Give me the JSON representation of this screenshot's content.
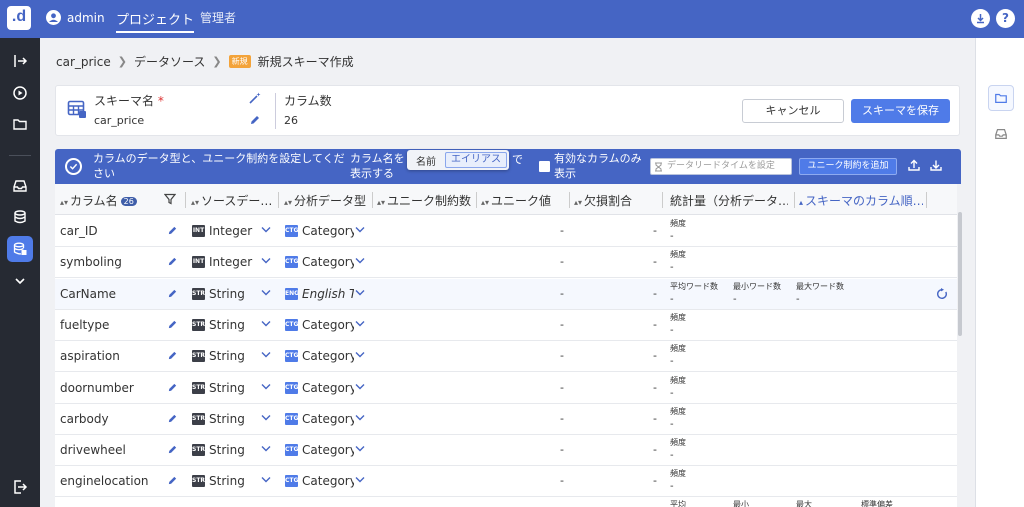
{
  "topbar": {
    "logo": ".d",
    "user": "admin",
    "nav_project": "プロジェクト",
    "nav_admin": "管理者",
    "help": "?"
  },
  "breadcrumb": {
    "items": [
      "car_price",
      "データソース"
    ],
    "badge": "新規",
    "current": "新規スキーマ作成"
  },
  "header": {
    "schema_label": "スキーマ名",
    "required_mark": "*",
    "schema_value": "car_price",
    "column_count_label": "カラム数",
    "column_count_value": "26",
    "cancel_label": "キャンセル",
    "save_label": "スキーマを保存"
  },
  "infobar": {
    "text": "カラムのデータ型と、ユニーク制約を設定してください",
    "column_name_text": "カラム名を表示する",
    "toggle_name": "名前",
    "toggle_alias": "エイリアス",
    "de": "で",
    "valid_only": "有効なカラムのみ表示",
    "leadtime_placeholder": "データリードタイムを設定",
    "add_unique_label": "ユニーク制約を追加"
  },
  "table": {
    "headers": {
      "column_name": "カラム名",
      "count": "26",
      "source_type": "ソースデー…",
      "analysis_type": "分析データ型",
      "unique_constraints": "ユニーク制約数",
      "unique_values": "ユニーク値",
      "missing_ratio": "欠損割合",
      "stats": "統計量（分析データ…",
      "schema_order": "スキーマのカラム順…"
    },
    "rows": [
      {
        "name": "car_ID",
        "src_tag": "INT",
        "src": "Integer",
        "ana_tag": "CTG",
        "ana": "Category",
        "unique": "-",
        "missing": "-",
        "stats": [
          {
            "label": "頻度",
            "value": "-"
          }
        ]
      },
      {
        "name": "symboling",
        "src_tag": "INT",
        "src": "Integer",
        "ana_tag": "CTG",
        "ana": "Category",
        "unique": "-",
        "missing": "-",
        "stats": [
          {
            "label": "頻度",
            "value": "-"
          }
        ]
      },
      {
        "name": "CarName",
        "src_tag": "STR",
        "src": "String",
        "ana_tag": "ENG",
        "ana": "English Te",
        "unique": "-",
        "missing": "-",
        "stats": [
          {
            "label": "平均ワード数",
            "value": "-"
          },
          {
            "label": "最小ワード数",
            "value": "-"
          },
          {
            "label": "最大ワード数",
            "value": "-"
          }
        ]
      },
      {
        "name": "fueltype",
        "src_tag": "STR",
        "src": "String",
        "ana_tag": "CTG",
        "ana": "Category",
        "unique": "-",
        "missing": "-",
        "stats": [
          {
            "label": "頻度",
            "value": "-"
          }
        ]
      },
      {
        "name": "aspiration",
        "src_tag": "STR",
        "src": "String",
        "ana_tag": "CTG",
        "ana": "Category",
        "unique": "-",
        "missing": "-",
        "stats": [
          {
            "label": "頻度",
            "value": "-"
          }
        ]
      },
      {
        "name": "doornumber",
        "src_tag": "STR",
        "src": "String",
        "ana_tag": "CTG",
        "ana": "Category",
        "unique": "-",
        "missing": "-",
        "stats": [
          {
            "label": "頻度",
            "value": "-"
          }
        ]
      },
      {
        "name": "carbody",
        "src_tag": "STR",
        "src": "String",
        "ana_tag": "CTG",
        "ana": "Category",
        "unique": "-",
        "missing": "-",
        "stats": [
          {
            "label": "頻度",
            "value": "-"
          }
        ]
      },
      {
        "name": "drivewheel",
        "src_tag": "STR",
        "src": "String",
        "ana_tag": "CTG",
        "ana": "Category",
        "unique": "-",
        "missing": "-",
        "stats": [
          {
            "label": "頻度",
            "value": "-"
          }
        ]
      },
      {
        "name": "enginelocation",
        "src_tag": "STR",
        "src": "String",
        "ana_tag": "CTG",
        "ana": "Category",
        "unique": "-",
        "missing": "-",
        "stats": [
          {
            "label": "頻度",
            "value": "-"
          }
        ]
      }
    ],
    "partial_stats": [
      "平均",
      "最小",
      "最大",
      "標準偏差"
    ]
  },
  "icons": {
    "sidebar": [
      "pipeline-icon",
      "play-circle-icon",
      "folder-icon",
      "inbox-icon",
      "database-icon",
      "schema-db-icon",
      "chevron-down-icon",
      "logout-icon"
    ],
    "rightrail": [
      "folder-icon",
      "inbox-icon"
    ]
  },
  "colors": {
    "primary": "#4565c4",
    "accent": "#4f7be8",
    "sidebar": "#262a33",
    "badge": "#f3a33a"
  }
}
